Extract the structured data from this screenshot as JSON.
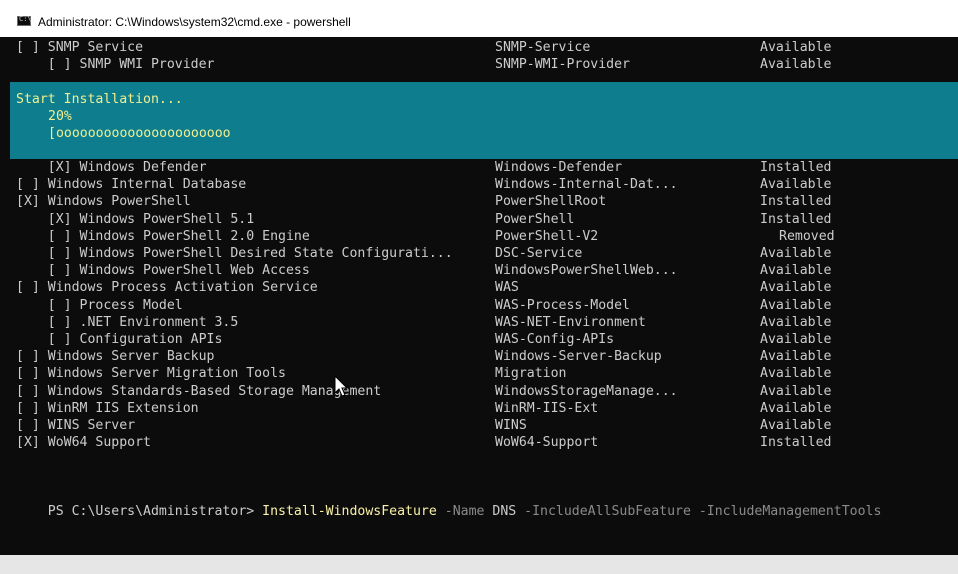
{
  "window": {
    "title": "Administrator: C:\\Windows\\system32\\cmd.exe - powershell",
    "icon": "cmd-icon"
  },
  "top_rows": [
    {
      "name": "[ ] SNMP Service",
      "id": "SNMP-Service",
      "status": "Available"
    },
    {
      "name": "    [ ] SNMP WMI Provider",
      "id": "SNMP-WMI-Provider",
      "status": "Available"
    }
  ],
  "progress": {
    "label": "Start Installation...",
    "percent_text": "20%",
    "bar": "[oooooooooooooooooooooo",
    "percent": 20,
    "bg_color": "#0e7d8d",
    "text_color": "#f0ef90"
  },
  "rows": [
    {
      "name": "    [X] Windows Defender",
      "id": "Windows-Defender",
      "status": "Installed"
    },
    {
      "name": "[ ] Windows Internal Database",
      "id": "Windows-Internal-Dat...",
      "status": "Available"
    },
    {
      "name": "[X] Windows PowerShell",
      "id": "PowerShellRoot",
      "status": "Installed"
    },
    {
      "name": "    [X] Windows PowerShell 5.1",
      "id": "PowerShell",
      "status": "Installed"
    },
    {
      "name": "    [ ] Windows PowerShell 2.0 Engine",
      "id": "PowerShell-V2",
      "status": "Removed"
    },
    {
      "name": "    [ ] Windows PowerShell Desired State Configurati...",
      "id": "DSC-Service",
      "status": "Available"
    },
    {
      "name": "    [ ] Windows PowerShell Web Access",
      "id": "WindowsPowerShellWeb...",
      "status": "Available"
    },
    {
      "name": "[ ] Windows Process Activation Service",
      "id": "WAS",
      "status": "Available"
    },
    {
      "name": "    [ ] Process Model",
      "id": "WAS-Process-Model",
      "status": "Available"
    },
    {
      "name": "    [ ] .NET Environment 3.5",
      "id": "WAS-NET-Environment",
      "status": "Available"
    },
    {
      "name": "    [ ] Configuration APIs",
      "id": "WAS-Config-APIs",
      "status": "Available"
    },
    {
      "name": "[ ] Windows Server Backup",
      "id": "Windows-Server-Backup",
      "status": "Available"
    },
    {
      "name": "[ ] Windows Server Migration Tools",
      "id": "Migration",
      "status": "Available"
    },
    {
      "name": "[ ] Windows Standards-Based Storage Management",
      "id": "WindowsStorageManage...",
      "status": "Available"
    },
    {
      "name": "[ ] WinRM IIS Extension",
      "id": "WinRM-IIS-Ext",
      "status": "Available"
    },
    {
      "name": "[ ] WINS Server",
      "id": "WINS",
      "status": "Available"
    },
    {
      "name": "[X] WoW64 Support",
      "id": "WoW64-Support",
      "status": "Installed"
    }
  ],
  "prompt": {
    "ps": "PS C:\\Users\\Administrator> ",
    "cmdlet": "Install-WindowsFeature",
    "p1": " -Name ",
    "a1": "DNS",
    "p2": " -IncludeAllSubFeature -IncludeManagementTools",
    "cmdlet_color": "#f9f1a5",
    "param_color": "#8a8a8a"
  }
}
